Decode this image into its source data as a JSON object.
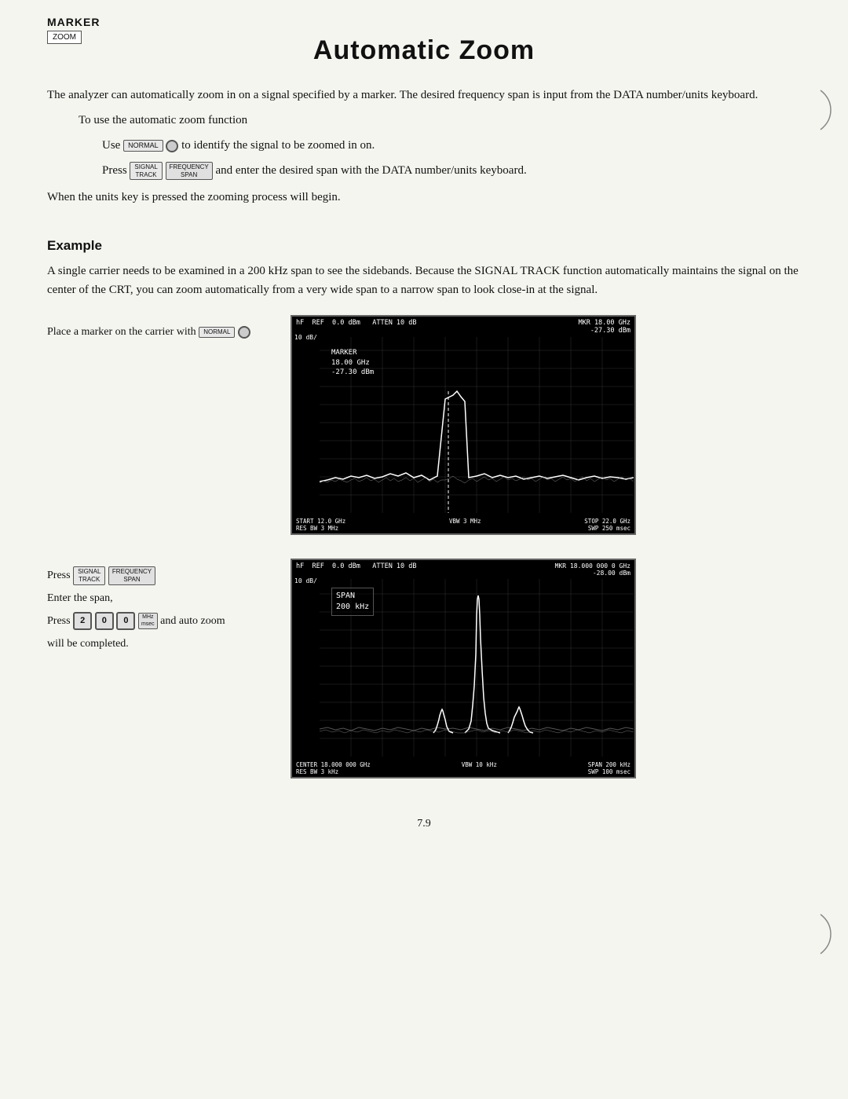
{
  "page": {
    "title": "Automatic Zoom",
    "page_number": "7.9"
  },
  "marker": {
    "label": "MARKER",
    "zoom_btn": "ZOOM"
  },
  "intro": {
    "para1": "The analyzer can automatically zoom in on a signal specified by a marker. The desired frequency span is input from the DATA number/units keyboard.",
    "para2": "To use the automatic zoom function",
    "line1": "Use",
    "line1_suffix": "to identify the signal to be zoomed in on.",
    "line2_prefix": "Press",
    "line2_suffix": "and  enter the desired span with the DATA number/units keyboard.",
    "para3": "When the units key is pressed the zooming process will  begin."
  },
  "example": {
    "heading": "Example",
    "description": "A single carrier needs to be examined in a 200 kHz span to see the sidebands. Because the SIGNAL TRACK function automatically maintains the signal on the center of the CRT, you can zoom automatically from a very wide span to a narrow span to look close-in at the signal.",
    "step1_text": "Place a marker on the carrier with",
    "step2_lines": [
      "Press",
      "Enter the span,",
      "Press",
      "and auto zoom",
      "will be completed."
    ],
    "screen1": {
      "top_left": "hF  REF  0.0 dBm   ATTEN 10 dB",
      "top_right": "MKR 18.00 GHz\n-27.30 dBm",
      "scale": "10 dB/",
      "marker_info": "MARKER\n18.00 GHz\n-27.30 dBm",
      "bottom_left": "START 12.0 GHz\nRES BW 3 MHz",
      "bottom_center": "VBW 3 MHz",
      "bottom_right": "STOP 22.0 GHz\nSWP 250 msec"
    },
    "screen2": {
      "top_left": "hF  REF  0.0 dBm   ATTEN 10 dB",
      "top_right": "MKR 18.000 000 0 GHz\n-28.00 dBm",
      "scale": "10 dB/",
      "span_info": "SPAN\n200 kHz",
      "bottom_left": "CENTER 18.000 000 GHz\nRES BW 3 kHz",
      "bottom_center": "VBW 10 kHz",
      "bottom_right": "SPAN 200 kHz\nSWP 100 msec"
    }
  },
  "keys": {
    "signal": "SIGNAL\nTRACK",
    "frequency_span": "FREQUENCY\nSPAN",
    "normal": "NORMAL",
    "two": "2",
    "zero": "0",
    "zero2": "0",
    "mhz": "MHz\nmsec"
  }
}
